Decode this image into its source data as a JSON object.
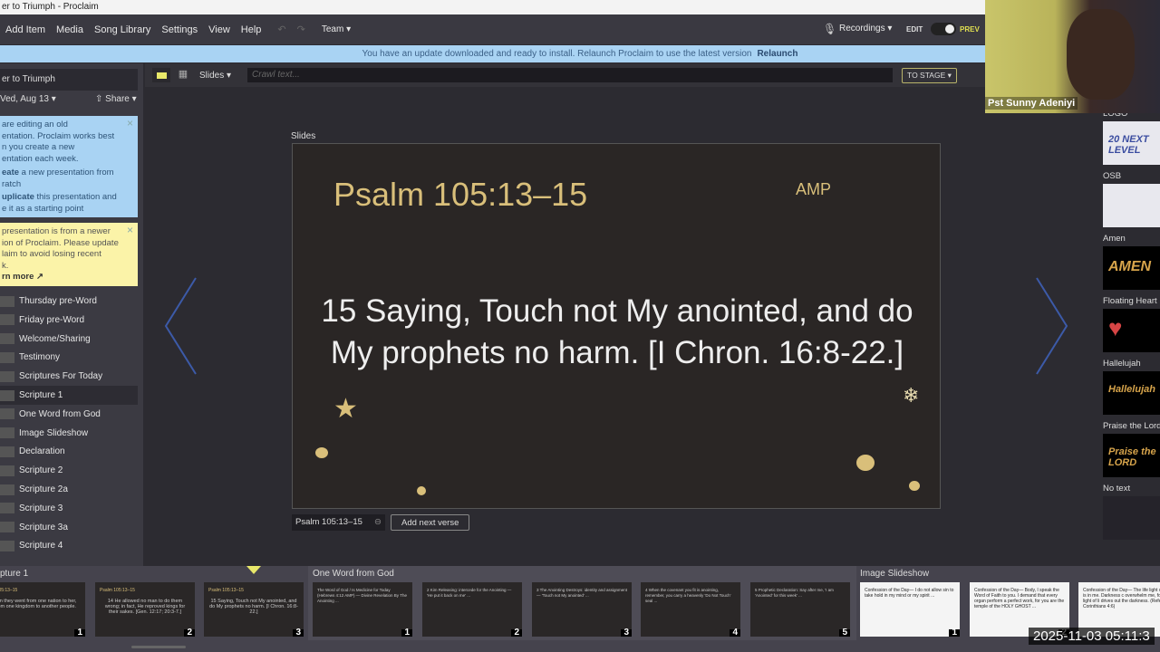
{
  "window_title": "er to Triumph - Proclaim",
  "menu": [
    "Add Item",
    "Media",
    "Song Library",
    "Settings",
    "View",
    "Help"
  ],
  "team": "Team ▾",
  "recordings": "Recordings ▾",
  "edit": "EDIT",
  "preview": "PREV",
  "banner": {
    "text": "You have an update downloaded and ready to install. Relaunch Proclaim to use the latest version",
    "action": "Relaunch"
  },
  "left": {
    "presentation": "er to Triumph",
    "date": "Ved, Aug 13 ▾",
    "share": "Share ▾",
    "note1": {
      "l1": "are editing an old",
      "l2": "entation. Proclaim works best",
      "l3": "n you create a new",
      "l4": "entation each week.",
      "create_b": "eate",
      "create": " a new presentation from",
      "create2": "ratch",
      "dup_b": "uplicate",
      "dup": " this presentation and",
      "dup2": "e it as a starting point"
    },
    "note2": {
      "l1": "presentation is from a newer",
      "l2": "ion of Proclaim. Please update",
      "l3": "laim to avoid losing recent",
      "l4": "k.",
      "learn": "rn more ↗"
    },
    "items": [
      "Thursday pre-Word",
      "Friday pre-Word",
      "Welcome/Sharing",
      "Testimony",
      "Scriptures For Today",
      "Scripture 1",
      "One Word from God",
      "Image Slideshow",
      "Declaration",
      "Scripture 2",
      "Scripture 2a",
      "Scripture 3",
      "Scripture 3a",
      "Scripture 4"
    ]
  },
  "toolbar": {
    "slides": "Slides ▾",
    "crawl_placeholder": "Crawl text...",
    "to_stage": "TO STAGE ▾"
  },
  "slides_label": "Slides",
  "slide": {
    "reference": "Psalm 105:13–15",
    "version": "AMP",
    "text": "15 Saying, Touch not My anointed, and do My prophets no harm. [I Chron. 16:8-22.]"
  },
  "slide_ref_chip": "Psalm 105:13–15",
  "add_next_verse": "Add next verse",
  "film": {
    "groups": [
      "pture 1",
      "One Word from God",
      "Image Slideshow"
    ],
    "scripture": [
      {
        "ref": "lm 105:13–15",
        "text": "hen they went from one nation to her, from one kingdom to another people.",
        "n": "1"
      },
      {
        "ref": "Psalm 105:13–15",
        "text": "14 He allowed no man to do them wrong; in fact, He reproved kings for their sakes. [Gen. 12:17; 20:3-7.]",
        "n": "2"
      },
      {
        "ref": "Psalm 105:13–15",
        "text": "15 Saying, Touch not My anointed, and do My prophets no harm. [I Chron. 16:8-22.]",
        "n": "3"
      }
    ],
    "word": [
      {
        "text": "The Word of God / Is Medicine for Today (Hebrews 4:12 AMP) — Divine Revelation By The Anointing ...",
        "n": "1"
      },
      {
        "text": "2 Kim Releasing: intercede for the Anointing — 'He put it back on me' ...",
        "n": "2"
      },
      {
        "text": "3 The Anointing Destroys: identity and assignment — 'Touch not My anointed' ...",
        "n": "3"
      },
      {
        "text": "4 When the covenant you fit is anointing, remember, you carry a heavenly 'Do Not Touch' seal ...",
        "n": "4"
      },
      {
        "text": "5 Prophetic Declaration: Say after me, 'I am 'Anointed' for this week' ...",
        "n": "5"
      }
    ],
    "images": [
      {
        "text": "Confession of the Day— I do not allow sin to take hold in my mind or my spirit ...",
        "n": "1"
      },
      {
        "text": "Confession of the Day— Body, I speak the Word of Faith to you. I demand that every organ perform a perfect work, for you are the temple of the HOLY GHOST ...",
        "n": "2"
      },
      {
        "text": "Confession of the Day— The life light of God is in me. Darkness c overwhelm me, for the light of li drives out the darkness. (Refere 2 Corinthians 4:6)",
        "n": ""
      }
    ]
  },
  "right": [
    {
      "label": "LOGO",
      "thumb": "20 NEXT LEVEL"
    },
    {
      "label": "OSB",
      "thumb": ""
    },
    {
      "label": "Amen",
      "thumb": "AMEN"
    },
    {
      "label": "Floating Heart",
      "thumb": "♥"
    },
    {
      "label": "Hallelujah",
      "thumb": "Hallelujah"
    },
    {
      "label": "Praise the Lord",
      "thumb": "Praise the LORD"
    },
    {
      "label": "No text",
      "thumb": ""
    }
  ],
  "webcam_name": "Pst Sunny Adeniyi",
  "timestamp": "2025-11-03 05:11:3",
  "colors": {
    "accent_yellow": "#e8e86a",
    "banner": "#a9d3f3",
    "slide_gold": "#d9bf7a"
  }
}
